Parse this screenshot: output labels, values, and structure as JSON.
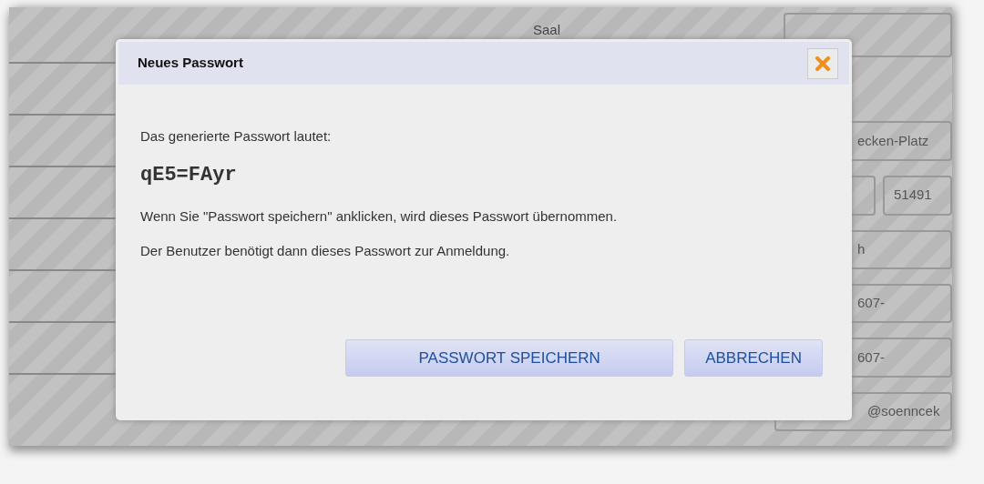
{
  "background_form": {
    "label": "Saal",
    "fields": [
      {
        "kind": "wide",
        "value": "ecken-Platz"
      },
      {
        "kind": "split",
        "value": "51491"
      },
      {
        "kind": "wide",
        "value": "h"
      },
      {
        "kind": "wide",
        "value": "607-"
      },
      {
        "kind": "wide",
        "value": "607-"
      },
      {
        "kind": "long",
        "value": "@soenncek"
      }
    ]
  },
  "dialog": {
    "title": "Neues Passwort",
    "message": "Das generierte Passwort lautet:",
    "password": "qE5=FAyr",
    "note": "Wenn Sie \"Passwort speichern\" anklicken, wird dieses Passwort übernommen.",
    "info": "Der Benutzer benötigt dann dieses Passwort zur Anmeldung.",
    "buttons": [
      {
        "label": "PASSWORT SPEICHERN"
      },
      {
        "label": "ABBRECHEN"
      }
    ]
  }
}
